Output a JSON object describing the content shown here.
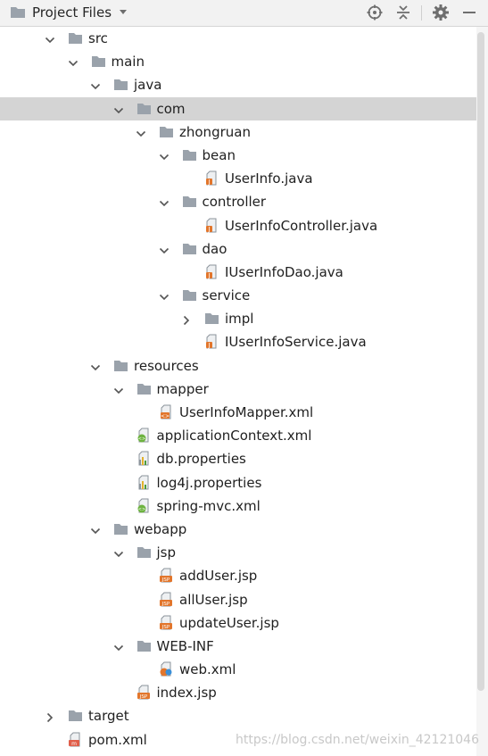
{
  "header": {
    "title": "Project Files",
    "icons": [
      "locate-icon",
      "collapse-all-icon",
      "settings-gear-icon",
      "minimize-icon"
    ]
  },
  "colors": {
    "folder": "#9aa2ab",
    "selected_row": "#d4d4d4",
    "java_file": "#e2762c",
    "spring_leaf": "#6db33f",
    "jsp_badge": "#e2762c"
  },
  "tree": [
    {
      "label": "src",
      "depth": 0,
      "type": "folder",
      "state": "open"
    },
    {
      "label": "main",
      "depth": 1,
      "type": "folder",
      "state": "open"
    },
    {
      "label": "java",
      "depth": 2,
      "type": "folder",
      "state": "open"
    },
    {
      "label": "com",
      "depth": 3,
      "type": "folder",
      "state": "open",
      "selected": true
    },
    {
      "label": "zhongruan",
      "depth": 4,
      "type": "folder",
      "state": "open"
    },
    {
      "label": "bean",
      "depth": 5,
      "type": "folder",
      "state": "open"
    },
    {
      "label": "UserInfo.java",
      "depth": 6,
      "type": "java"
    },
    {
      "label": "controller",
      "depth": 5,
      "type": "folder",
      "state": "open"
    },
    {
      "label": "UserInfoController.java",
      "depth": 6,
      "type": "java"
    },
    {
      "label": "dao",
      "depth": 5,
      "type": "folder",
      "state": "open"
    },
    {
      "label": "IUserInfoDao.java",
      "depth": 6,
      "type": "java"
    },
    {
      "label": "service",
      "depth": 5,
      "type": "folder",
      "state": "open"
    },
    {
      "label": "impl",
      "depth": 6,
      "type": "folder",
      "state": "closed"
    },
    {
      "label": "IUserInfoService.java",
      "depth": 6,
      "type": "java"
    },
    {
      "label": "resources",
      "depth": 2,
      "type": "folder",
      "state": "open"
    },
    {
      "label": "mapper",
      "depth": 3,
      "type": "folder",
      "state": "open"
    },
    {
      "label": "UserInfoMapper.xml",
      "depth": 4,
      "type": "xml"
    },
    {
      "label": "applicationContext.xml",
      "depth": 3,
      "type": "spring-xml"
    },
    {
      "label": "db.properties",
      "depth": 3,
      "type": "properties"
    },
    {
      "label": "log4j.properties",
      "depth": 3,
      "type": "properties"
    },
    {
      "label": "spring-mvc.xml",
      "depth": 3,
      "type": "spring-xml"
    },
    {
      "label": "webapp",
      "depth": 2,
      "type": "folder",
      "state": "open"
    },
    {
      "label": "jsp",
      "depth": 3,
      "type": "folder",
      "state": "open"
    },
    {
      "label": "addUser.jsp",
      "depth": 4,
      "type": "jsp"
    },
    {
      "label": "allUser.jsp",
      "depth": 4,
      "type": "jsp"
    },
    {
      "label": "updateUser.jsp",
      "depth": 4,
      "type": "jsp"
    },
    {
      "label": "WEB-INF",
      "depth": 3,
      "type": "folder",
      "state": "open"
    },
    {
      "label": "web.xml",
      "depth": 4,
      "type": "web-xml"
    },
    {
      "label": "index.jsp",
      "depth": 3,
      "type": "jsp"
    },
    {
      "label": "target",
      "depth": 0,
      "type": "folder",
      "state": "closed"
    },
    {
      "label": "pom.xml",
      "depth": 0,
      "type": "maven-xml"
    }
  ],
  "watermark": "https://blog.csdn.net/weixin_42121046"
}
